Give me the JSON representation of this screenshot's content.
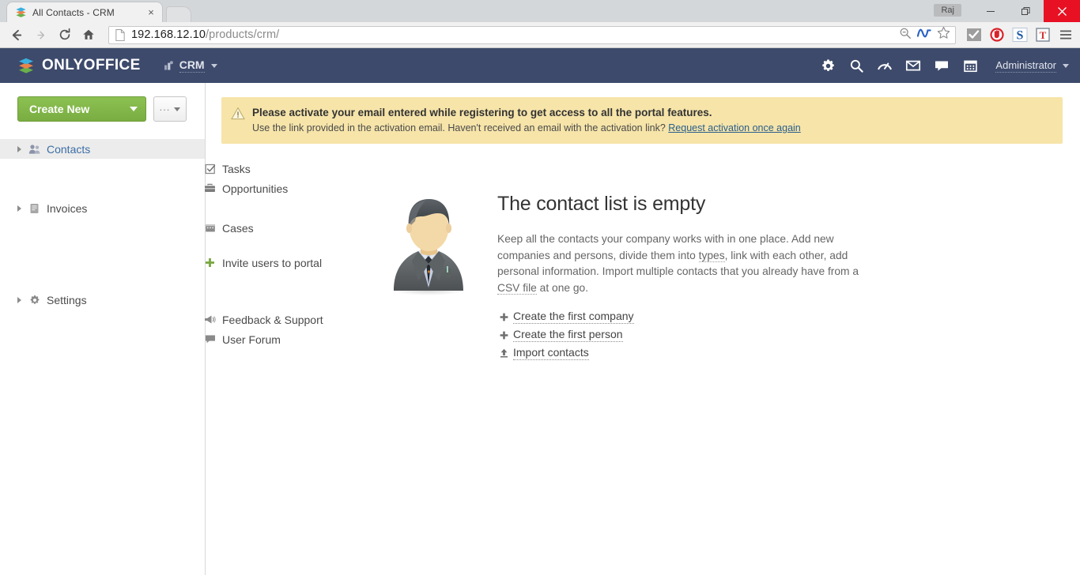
{
  "browser": {
    "tab": {
      "title": "All Contacts - CRM",
      "favicon": "onlyoffice-stack-icon",
      "close_label": "×"
    },
    "window": {
      "user_badge": "Raj",
      "minimize": "minimize-icon",
      "maximize": "restore-icon",
      "close": "close-icon"
    },
    "toolbar": {
      "back": "back-arrow-icon",
      "forward": "forward-arrow-icon",
      "reload": "reload-icon",
      "home": "home-icon",
      "url_host": "192.168.12.10",
      "url_path": "/products/crm/",
      "omnibox_icons": [
        "zoom-out-icon",
        "wave-icon",
        "bookmark-star-icon"
      ],
      "extensions": [
        "checkmark-extension-icon",
        "adblock-icon",
        "s-extension-icon",
        "t-extension-icon",
        "chrome-menu-icon"
      ]
    }
  },
  "header": {
    "logo_text": "ONLYOFFICE",
    "module": "CRM",
    "icons": [
      "gear-icon",
      "search-icon",
      "feed-gauge-icon",
      "mail-icon",
      "chat-icon",
      "calendar-icon"
    ],
    "user": "Administrator"
  },
  "sidebar": {
    "create_new": "Create New",
    "more_button": "...",
    "items": [
      {
        "label": "Contacts",
        "icon": "people-icon",
        "expandable": true,
        "active": true
      },
      {
        "label": "Tasks",
        "icon": "task-check-icon",
        "expandable": false,
        "active": false
      },
      {
        "label": "Opportunities",
        "icon": "briefcase-icon",
        "expandable": false,
        "active": false
      },
      {
        "label": "Invoices",
        "icon": "document-icon",
        "expandable": true,
        "active": false
      },
      {
        "label": "Cases",
        "icon": "case-folder-icon",
        "expandable": false,
        "active": false
      }
    ],
    "invite": {
      "label": "Invite users to portal",
      "icon": "plus-icon"
    },
    "bottom_items": [
      {
        "label": "Settings",
        "icon": "gear-icon",
        "expandable": true
      },
      {
        "label": "Feedback & Support",
        "icon": "megaphone-icon",
        "expandable": false
      },
      {
        "label": "User Forum",
        "icon": "comment-icon",
        "expandable": false
      }
    ]
  },
  "banner": {
    "icon": "warning-triangle-icon",
    "line1": "Please activate your email entered while registering to get access to all the portal features.",
    "line2_prefix": "Use the link provided in the activation email. Haven't received an email with the activation link?",
    "link": "Request activation once again"
  },
  "empty_state": {
    "avatar": "businessman-avatar-illustration",
    "title": "The contact list is empty",
    "desc_part1": "Keep all the contacts your company works with in one place. Add new companies and persons, divide them into ",
    "desc_term1": "types",
    "desc_part2": ", link with each other, add personal information. Import multiple contacts that you already have from a ",
    "desc_term2": "CSV file",
    "desc_part3": " at one go.",
    "actions": [
      {
        "label": "Create the first company",
        "icon": "plus-icon"
      },
      {
        "label": "Create the first person",
        "icon": "plus-icon"
      },
      {
        "label": "Import contacts",
        "icon": "upload-icon"
      }
    ]
  },
  "colors": {
    "header_bg": "#3d4a6b",
    "accent_green": "#8cc152",
    "banner_bg": "#f6e4a9",
    "active_link": "#3b6ea5",
    "close_red": "#e81123"
  }
}
